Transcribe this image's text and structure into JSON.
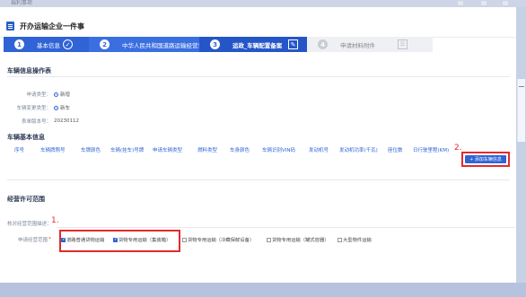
{
  "top_strip": {
    "title": "福利事项"
  },
  "page": {
    "title": "开办运输企业一件事"
  },
  "steps": [
    {
      "num": "1",
      "label": "基本信息",
      "done": true
    },
    {
      "num": "2",
      "label": "中华人民共和国道路运输经营许可",
      "done": true
    },
    {
      "num": "3",
      "label": "运政_车辆配置备案",
      "current": true
    },
    {
      "num": "4",
      "label": "申请材料附件"
    }
  ],
  "vehicle_op": {
    "title": "车辆信息操作表",
    "fields": [
      {
        "label": "申请类型：",
        "value": "新增"
      },
      {
        "label": "车辆变更类型：",
        "value": "新车"
      },
      {
        "label": "表单版本号：",
        "value": "20230112"
      }
    ]
  },
  "vehicle_basic": {
    "title": "车辆基本信息",
    "columns": [
      "序号",
      "车辆牌照号",
      "车牌颜色",
      "车辆(挂车)号牌",
      "申请车辆类型",
      "燃料类型",
      "车身颜色",
      "车辆识别VIN码",
      "发动机号",
      "发动机功率(千瓦)",
      "座位数",
      "日行驶里程(KM)"
    ],
    "add_button": "+ 添加车辆信息"
  },
  "permit": {
    "title": "经营许可范围",
    "scope_label": "核对经营范围描述：",
    "apply_label": "申请经营范围",
    "required_mark": "*",
    "options": [
      {
        "label": "道路普通货物运输",
        "checked": true
      },
      {
        "label": "货物专用运输（集装箱）",
        "checked": true
      },
      {
        "label": "货物专用运输（冷藏保鲜设备）",
        "checked": false
      },
      {
        "label": "货物专用运输（罐式容器）",
        "checked": false
      },
      {
        "label": "大型物件运输",
        "checked": false
      }
    ]
  },
  "annotations": {
    "mark1": "1.",
    "mark2": "2."
  },
  "colors": {
    "primary": "#2f63d6",
    "annotation": "#e12b2b"
  }
}
